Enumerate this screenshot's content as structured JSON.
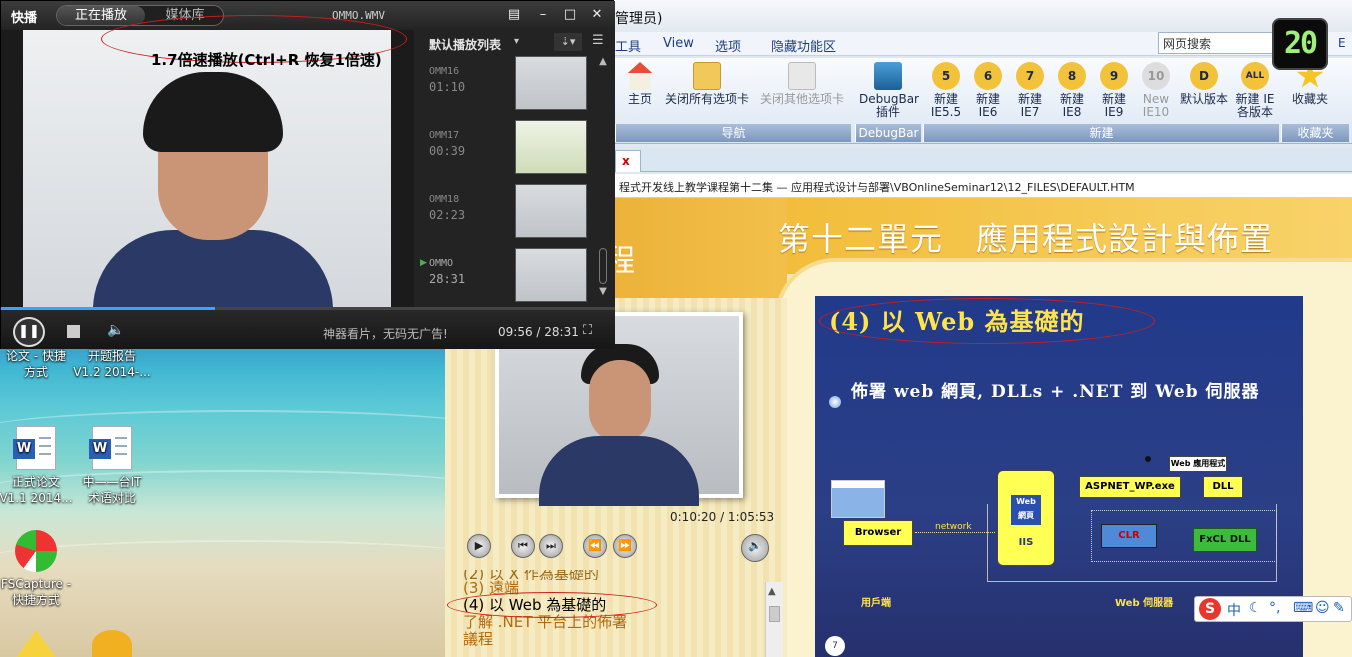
{
  "player": {
    "logo": "快播",
    "tab_playing": "正在播放",
    "tab_library": "媒体库",
    "filename": "OMMO.WMV",
    "overlay_text": "1.7倍速播放(Ctrl+R 恢复1倍速)",
    "playlist_title": "默认播放列表",
    "playlist": [
      {
        "name": "OMM16",
        "duration": "01:10"
      },
      {
        "name": "OMM17",
        "duration": "00:39"
      },
      {
        "name": "OMM18",
        "duration": "02:23"
      },
      {
        "name": "OMMO",
        "duration": "28:31"
      }
    ],
    "slogan": "神器看片，无码无广告!",
    "time": "09:56 / 28:31",
    "progress_fraction": 0.349
  },
  "browser": {
    "title": "管理员)",
    "menu": [
      "工具",
      "View",
      "选项",
      "隐藏功能区"
    ],
    "search_placeholder": "网页搜索",
    "ribbon": {
      "home": "主页",
      "close_all": "关闭所有选项卡",
      "close_others": "关闭其他选项卡",
      "debugbar_l1": "DebugBar",
      "debugbar_l2": "插件",
      "new_buttons": [
        {
          "l1": "新建",
          "l2": "IE5.5",
          "badge": "5"
        },
        {
          "l1": "新建",
          "l2": "IE6",
          "badge": "6"
        },
        {
          "l1": "新建",
          "l2": "IE7",
          "badge": "7"
        },
        {
          "l1": "新建",
          "l2": "IE8",
          "badge": "8"
        },
        {
          "l1": "新建",
          "l2": "IE9",
          "badge": "9"
        },
        {
          "l1": "New",
          "l2": "IE10",
          "badge": "10"
        }
      ],
      "default_version": "默认版本",
      "new_ie_l1": "新建 IE",
      "new_ie_l2": "各版本",
      "favorites": "收藏夹",
      "groups": {
        "nav": "导航",
        "debugbar": "DebugBar",
        "new": "新建",
        "fav": "收藏夹"
      }
    },
    "tab_close": "x",
    "address": "程式开发线上教学课程第十二集 — 应用程式设计与部署\\VBOnlineSeminar12\\12_FILES\\DEFAULT.HTM"
  },
  "page": {
    "cut_char": "程",
    "unit_title": "第十二單元　應用程式設計與佈置",
    "timecode": "0:10:20 / 1:05:53",
    "toc": [
      "(2) 以 X 作為基礎的",
      "(3) 遠端",
      "(4) 以  Web 為基礎的",
      "了解 .NET 平台上的佈署",
      "議程"
    ],
    "slide": {
      "heading": "(4) 以 Web 為基礎的",
      "bullet": "佈署 web 網頁, DLLs + .NET 到 Web 伺服器",
      "browser_box": "Browser",
      "network": "network",
      "web_page": "Web 網頁",
      "iis": "IIS",
      "webapp": "Web 應用程式",
      "aspnet": "ASPNET_WP.exe",
      "dll": "DLL",
      "clr": "CLR",
      "fxcl": "FxCL DLL",
      "client": "用戶端",
      "server": "Web 伺服器",
      "page_no": "7"
    }
  },
  "desktop": {
    "icons": [
      {
        "l1": "论文 - 快捷",
        "l2": "方式"
      },
      {
        "l1": "开题报告",
        "l2": "V1.2 2014-..."
      },
      {
        "l1": "正式论文",
        "l2": "V1.1 2014..."
      },
      {
        "l1": "中——台IT",
        "l2": "术语对比"
      },
      {
        "l1": "FSCapture -",
        "l2": "快捷方式"
      }
    ]
  },
  "clock": "20",
  "ime": "中"
}
